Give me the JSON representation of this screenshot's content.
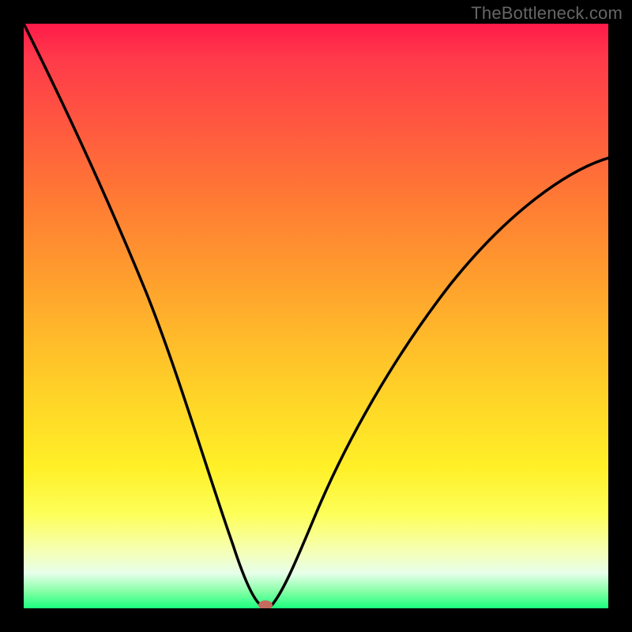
{
  "watermark": "TheBottleneck.com",
  "chart_data": {
    "type": "line",
    "title": "",
    "xlabel": "",
    "ylabel": "",
    "xlim": [
      0,
      100
    ],
    "ylim": [
      0,
      100
    ],
    "grid": false,
    "legend": false,
    "series": [
      {
        "name": "bottleneck-curve",
        "x": [
          0,
          5,
          10,
          15,
          20,
          25,
          30,
          35,
          38,
          40,
          41,
          42,
          44,
          48,
          55,
          62,
          70,
          78,
          86,
          94,
          100
        ],
        "values": [
          100,
          90,
          79,
          68,
          56,
          44,
          31,
          17,
          7,
          2,
          0,
          1,
          4,
          12,
          25,
          37,
          48,
          57,
          63,
          68,
          72
        ]
      }
    ],
    "marker": {
      "x": 41,
      "y": 0
    },
    "background_gradient": {
      "top": "#ff1a4a",
      "mid": "#ffd927",
      "bottom": "#1bff7e"
    }
  }
}
